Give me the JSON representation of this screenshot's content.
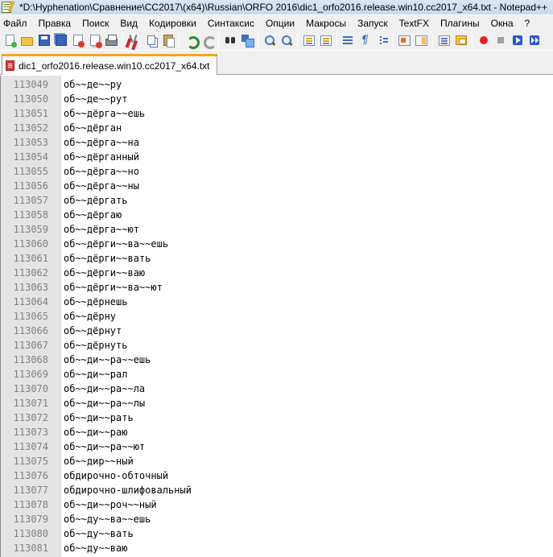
{
  "window": {
    "title": "*D:\\Hyphenation\\Сравнение\\CC2017\\(x64)\\Russian\\ORFO 2016\\dic1_orfo2016.release.win10.cc2017_x64.txt - Notepad++"
  },
  "menu": [
    "Файл",
    "Правка",
    "Поиск",
    "Вид",
    "Кодировки",
    "Синтаксис",
    "Опции",
    "Макросы",
    "Запуск",
    "TextFX",
    "Плагины",
    "Окна",
    "?"
  ],
  "toolbar": {
    "icons": [
      "new-file-icon",
      "open-file-icon",
      "save-icon",
      "save-all-icon",
      "close-icon",
      "close-all-icon",
      "print-icon",
      "cut-icon",
      "copy-icon",
      "paste-icon",
      "undo-icon",
      "redo-icon",
      "find-icon",
      "replace-icon",
      "zoom-in-icon",
      "zoom-out-icon",
      "sync-scroll-icon",
      "word-wrap-icon",
      "show-all-chars-icon",
      "indent-guide-icon",
      "user-defined-language-icon",
      "document-map-icon",
      "function-list-icon",
      "folder-as-workspace-icon",
      "record-macro-icon",
      "stop-record-icon",
      "play-macro-icon",
      "run-macro-multiple-icon"
    ],
    "all_chars_glyph": "¶"
  },
  "tab": {
    "label": "dic1_orfo2016.release.win10.cc2017_x64.txt",
    "accent_color": "#f6a623",
    "icon": "unsaved-file-icon"
  },
  "editor": {
    "lines": [
      {
        "n": "113049",
        "text": "об~~де~~ру"
      },
      {
        "n": "113050",
        "text": "об~~де~~рут"
      },
      {
        "n": "113051",
        "text": "об~~дёрга~~ешь"
      },
      {
        "n": "113052",
        "text": "об~~дёрган"
      },
      {
        "n": "113053",
        "text": "об~~дёрга~~на"
      },
      {
        "n": "113054",
        "text": "об~~дёрганный"
      },
      {
        "n": "113055",
        "text": "об~~дёрга~~но"
      },
      {
        "n": "113056",
        "text": "об~~дёрга~~ны"
      },
      {
        "n": "113057",
        "text": "об~~дёргать"
      },
      {
        "n": "113058",
        "text": "об~~дёргаю"
      },
      {
        "n": "113059",
        "text": "об~~дёрга~~ют"
      },
      {
        "n": "113060",
        "text": "об~~дёрги~~ва~~ешь"
      },
      {
        "n": "113061",
        "text": "об~~дёрги~~вать"
      },
      {
        "n": "113062",
        "text": "об~~дёрги~~ваю"
      },
      {
        "n": "113063",
        "text": "об~~дёрги~~ва~~ют"
      },
      {
        "n": "113064",
        "text": "об~~дёрнешь"
      },
      {
        "n": "113065",
        "text": "об~~дёрну"
      },
      {
        "n": "113066",
        "text": "об~~дёрнут"
      },
      {
        "n": "113067",
        "text": "об~~дёрнуть"
      },
      {
        "n": "113068",
        "text": "об~~ди~~ра~~ешь"
      },
      {
        "n": "113069",
        "text": "об~~ди~~рал"
      },
      {
        "n": "113070",
        "text": "об~~ди~~ра~~ла"
      },
      {
        "n": "113071",
        "text": "об~~ди~~ра~~лы"
      },
      {
        "n": "113072",
        "text": "об~~ди~~рать"
      },
      {
        "n": "113073",
        "text": "об~~ди~~раю"
      },
      {
        "n": "113074",
        "text": "об~~ди~~ра~~ют"
      },
      {
        "n": "113075",
        "text": "об~~дир~~ный"
      },
      {
        "n": "113076",
        "text": "обдирочно-обточный"
      },
      {
        "n": "113077",
        "text": "обдирочно-шлифовальный"
      },
      {
        "n": "113078",
        "text": "об~~ди~~роч~~ный"
      },
      {
        "n": "113079",
        "text": "об~~ду~~ва~~ешь"
      },
      {
        "n": "113080",
        "text": "об~~ду~~вать"
      },
      {
        "n": "113081",
        "text": "об~~ду~~ваю"
      }
    ]
  }
}
